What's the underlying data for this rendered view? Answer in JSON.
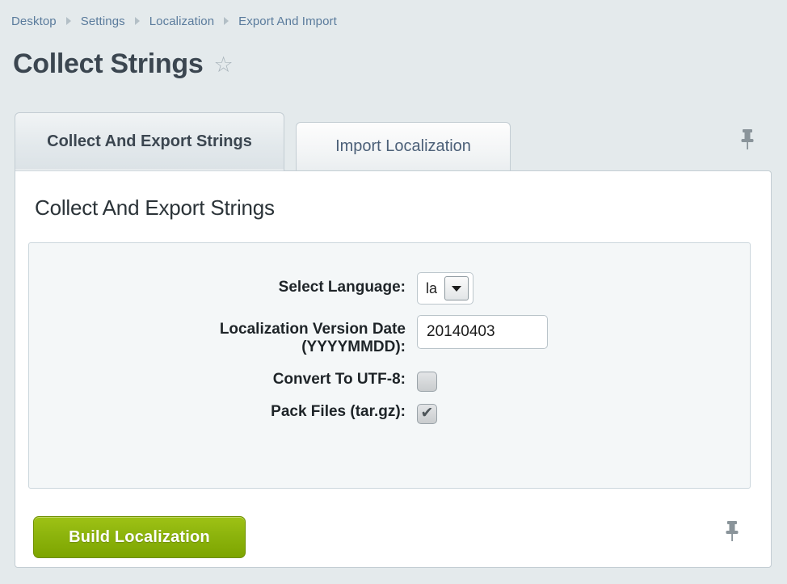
{
  "breadcrumb": {
    "separator_icon": "caret-right-icon",
    "items": [
      {
        "label": "Desktop"
      },
      {
        "label": "Settings"
      },
      {
        "label": "Localization"
      },
      {
        "label": "Export And Import"
      }
    ]
  },
  "header": {
    "title": "Collect Strings",
    "favorite_icon": "star-icon",
    "favorite_glyph": "☆"
  },
  "tabs": {
    "pin_icon": "pushpin-icon",
    "items": [
      {
        "label": "Collect And Export Strings",
        "active": true
      },
      {
        "label": "Import Localization",
        "active": false
      }
    ]
  },
  "main": {
    "section_title": "Collect And Export Strings",
    "pin_icon": "pushpin-icon",
    "form": {
      "language": {
        "label": "Select Language:",
        "value": "la",
        "arrow_icon": "chevron-down-icon"
      },
      "version_date": {
        "label_line1": "Localization Version Date",
        "label_line2": "(YYYYMMDD):",
        "value": "20140403",
        "placeholder": ""
      },
      "convert_utf8": {
        "label": "Convert To UTF-8:",
        "checked": false,
        "check_glyph": "✔"
      },
      "pack_files": {
        "label": "Pack Files (tar.gz):",
        "checked": true,
        "check_glyph": "✔"
      }
    },
    "build_button": {
      "label": "Build Localization"
    }
  },
  "colors": {
    "page_background": "#e4eaec",
    "breadcrumb_link": "#5a7b9c",
    "title_text": "#3b4650",
    "panel_background": "#ffffff",
    "fieldset_background": "#f4f7f8",
    "fieldset_border": "#ccd7dd",
    "button_green": "#8cb30c",
    "button_green_border": "#6f9000",
    "pin_grey": "#8a949a"
  }
}
